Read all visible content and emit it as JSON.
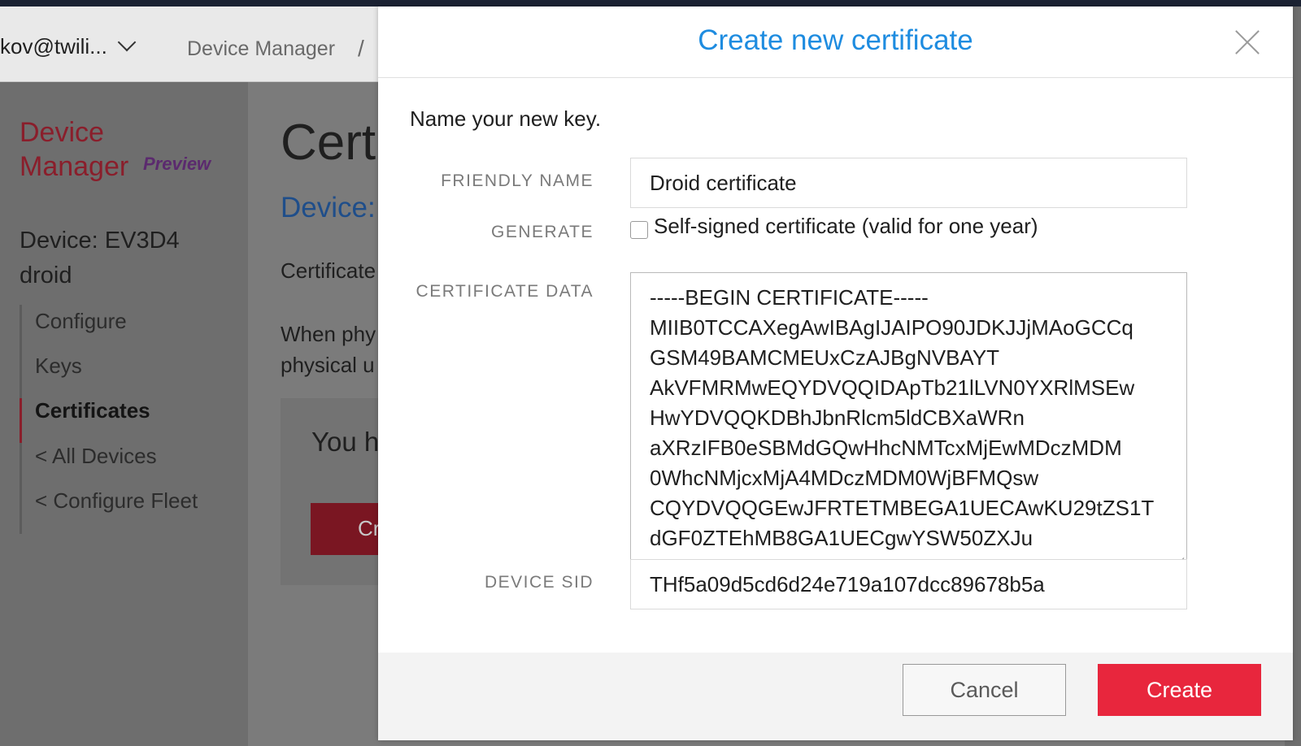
{
  "background": {
    "account": "kov@twili...",
    "breadcrumb": "Device Manager",
    "breadcrumb_sep": "/",
    "sidebar": {
      "title": "Device Manager",
      "badge": "Preview",
      "device": "Device: EV3D4 droid",
      "items": [
        {
          "label": "Configure"
        },
        {
          "label": "Keys"
        },
        {
          "label": "Certificates"
        },
        {
          "label": "< All Devices"
        },
        {
          "label": "< Configure Fleet"
        }
      ]
    },
    "page": {
      "heading": "Certi",
      "subheading": "Device:",
      "certificate_text": "Certificate",
      "when_line1": "When phy",
      "when_line2": "physical u",
      "you_text": "You h",
      "button_fragment": "Cr"
    }
  },
  "modal": {
    "title": "Create new certificate",
    "intro": "Name your new key.",
    "friendly_name": {
      "label": "FRIENDLY NAME",
      "value": "Droid certificate"
    },
    "generate": {
      "label": "GENERATE",
      "checkbox_label": "Self-signed certificate (valid for one year)",
      "checked": false
    },
    "certificate_data": {
      "label": "CERTIFICATE DATA",
      "lines": [
        "-----BEGIN CERTIFICATE-----",
        "MIIB0TCCAXegAwIBAgIJAIPO90JDKJJjMAoGCCq",
        "GSM49BAMCMEUxCzAJBgNVBAYT",
        "AkVFMRMwEQYDVQQIDApTb21lLVN0YXRlMSEw",
        "HwYDVQQKDBhJbnRlcm5ldCBXaWRn",
        "aXRzIFB0eSBMdGQwHhcNMTcxMjEwMDczMDM",
        "0WhcNMjcxMjA4MDczMDM0WjBFMQsw",
        "CQYDVQQGEwJFRTETMBEGA1UECAwKU29tZS1T",
        "dGF0ZTEhMB8GA1UECgwYSW50ZXJu"
      ]
    },
    "device_sid": {
      "label": "DEVICE SID",
      "value": "THf5a09d5cd6d24e719a107dcc89678b5a"
    },
    "buttons": {
      "cancel": "Cancel",
      "create": "Create"
    }
  }
}
